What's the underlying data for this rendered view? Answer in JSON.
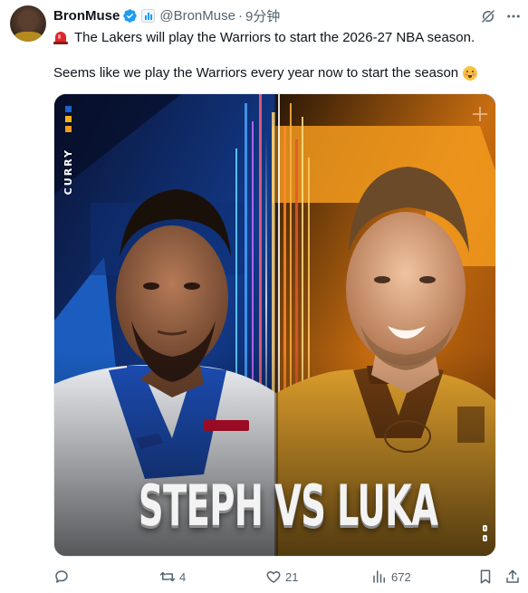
{
  "tweet": {
    "author_name": "BronMuse",
    "handle": "@BronMuse",
    "separator": "·",
    "time": "9分钟",
    "line1": "The Lakers will play the Warriors to start the 2026-27 NBA season.",
    "line2": "Seems like we play the Warriors every year now to start the season",
    "icons": {
      "line1_prefix": "police-car-light-emoji",
      "line2_suffix": "flushed-face-emoji",
      "verified": "verified-badge-icon",
      "affiliate": "affiliate-badge-icon",
      "grok": "grok-icon",
      "more": "more-options-icon"
    }
  },
  "media": {
    "vertical_label": "CURRY",
    "headline": "STEPH VS LUKA",
    "colors": {
      "warriors_blue": "#1d63c9",
      "lakers_gold": "#f29a1d",
      "navy": "#0c0f24"
    }
  },
  "actions": {
    "reply": {
      "icon": "reply-icon",
      "count": ""
    },
    "repost": {
      "icon": "repost-icon",
      "count": "4"
    },
    "like": {
      "icon": "heart-icon",
      "count": "21"
    },
    "views": {
      "icon": "views-icon",
      "count": "672"
    },
    "bookmark": {
      "icon": "bookmark-icon"
    },
    "share": {
      "icon": "share-icon"
    }
  },
  "colors": {
    "accent": "#1d9bf0",
    "muted": "#536471",
    "text": "#0f1419"
  }
}
